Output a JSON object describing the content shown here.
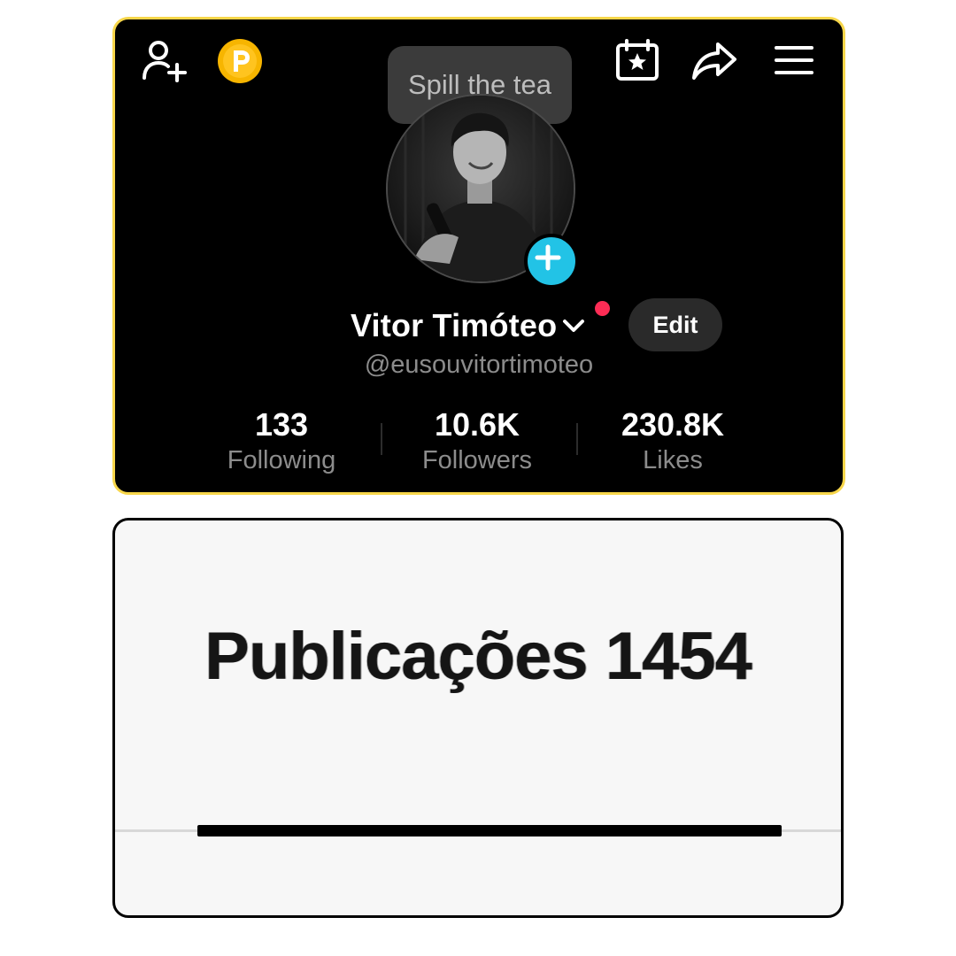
{
  "profile": {
    "tooltip_text": "Spill the tea",
    "display_name": "Vitor Timóteo",
    "username": "@eusouvitortimoteo",
    "edit_label": "Edit",
    "stats": {
      "following": {
        "value": "133",
        "label": "Following"
      },
      "followers": {
        "value": "10.6K",
        "label": "Followers"
      },
      "likes": {
        "value": "230.8K",
        "label": "Likes"
      }
    },
    "icons": {
      "top_left": [
        "add-friend-icon",
        "coin-icon"
      ],
      "top_right": [
        "calendar-star-icon",
        "share-icon",
        "menu-icon"
      ],
      "avatar_badge": "plus-icon",
      "name_suffix": "chevron-down-icon"
    },
    "colors": {
      "card_border": "#f7d64a",
      "coin": "#f7b500",
      "avatar_add": "#22c3e6",
      "notification_dot": "#fe2c55"
    }
  },
  "posts": {
    "tab_label": "Publicações 1454"
  }
}
